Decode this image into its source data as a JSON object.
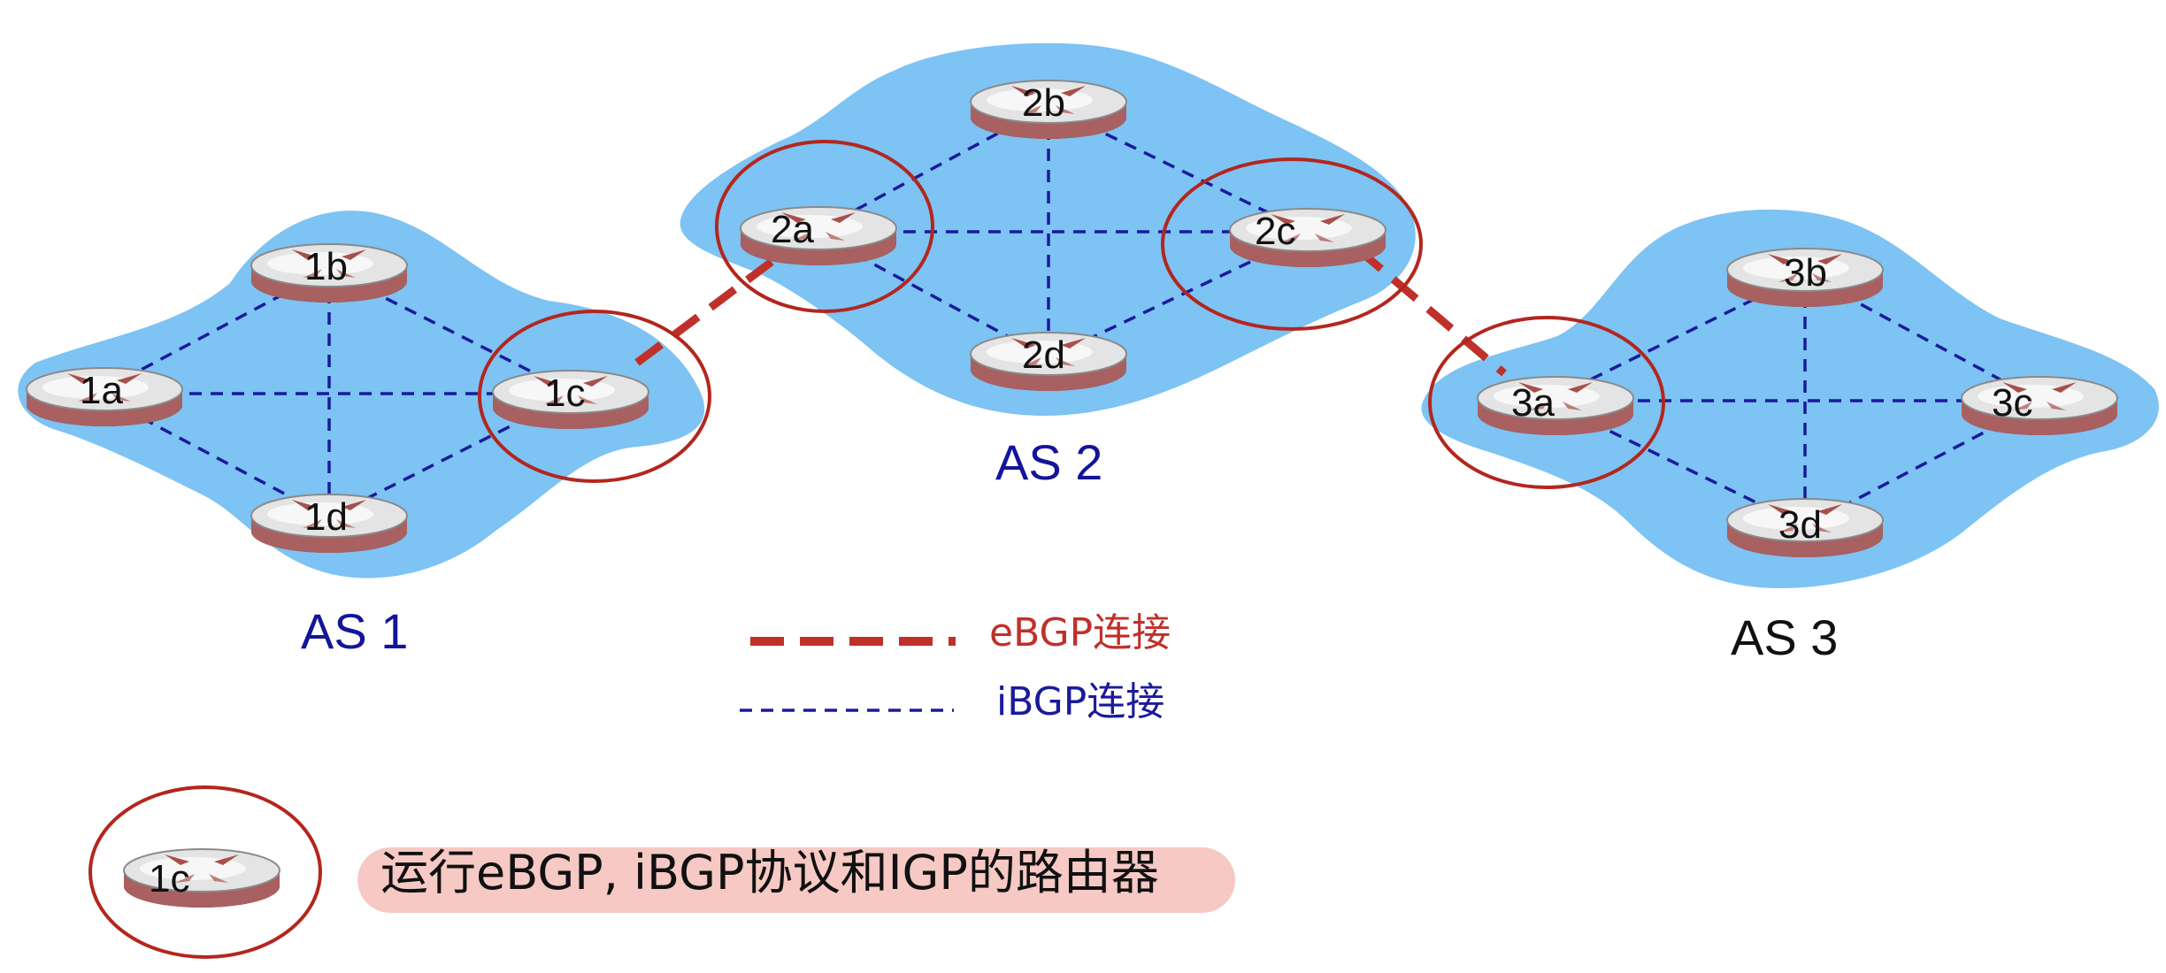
{
  "colors": {
    "cloud": "#7DC3F3",
    "ibgp": "#1A1A9C",
    "ebgp": "#C0302A",
    "as_label_blue": "#14149A",
    "as_label_black": "#111111",
    "caption_bg": "#F6C9C4",
    "router_top": "#E2E2E2",
    "router_body": "#9E5A5A"
  },
  "as_labels": {
    "as1": "AS 1",
    "as2": "AS 2",
    "as3": "AS 3"
  },
  "routers": {
    "r1a": "1a",
    "r1b": "1b",
    "r1c": "1c",
    "r1d": "1d",
    "r2a": "2a",
    "r2b": "2b",
    "r2c": "2c",
    "r2d": "2d",
    "r3a": "3a",
    "r3b": "3b",
    "r3c": "3c",
    "r3d": "3d"
  },
  "legend": {
    "ebgp": "eBGP连接",
    "ibgp": "iBGP连接",
    "router_label": "1c",
    "caption": "运行eBGP, iBGP协议和IGP的路由器"
  },
  "icons": {
    "router": "router-icon",
    "highlight": "highlight-circle-icon"
  }
}
